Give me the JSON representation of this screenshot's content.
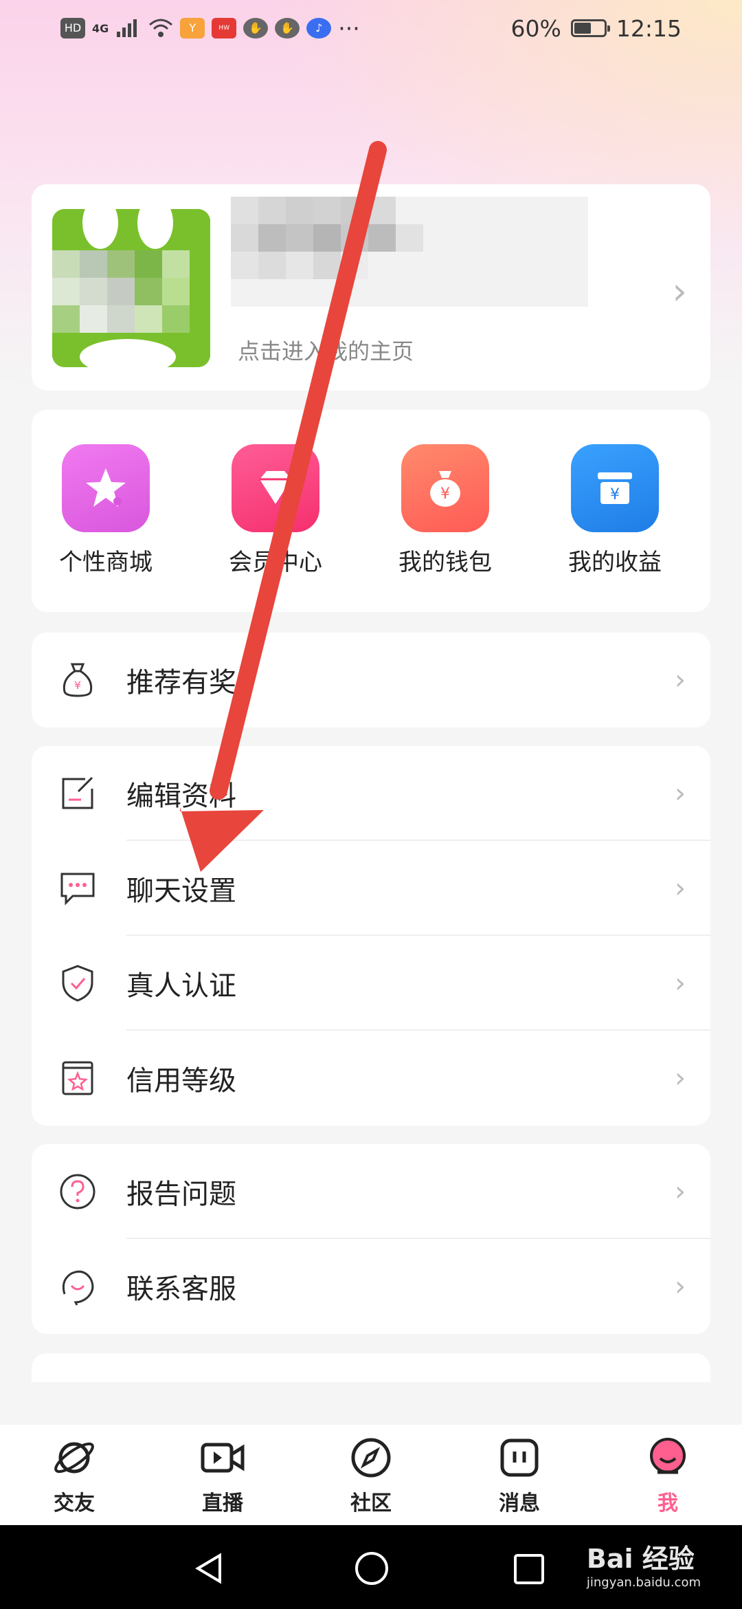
{
  "status_bar": {
    "badges": [
      "HD",
      "4G"
    ],
    "battery": "60%",
    "battery_level": 0.6,
    "time": "12:15",
    "more": "···"
  },
  "profile": {
    "subtitle": "点击进入我的主页"
  },
  "quick_actions": [
    {
      "label": "个性商城",
      "icon": "star-icon",
      "color": "#e760e6"
    },
    {
      "label": "会员中心",
      "icon": "diamond-icon",
      "color": "#ff3f86"
    },
    {
      "label": "我的钱包",
      "icon": "money-bag-icon",
      "color": "#ff6b5e"
    },
    {
      "label": "我的收益",
      "icon": "earnings-icon",
      "color": "#2f8df0"
    }
  ],
  "menu_group1": [
    {
      "label": "推荐有奖",
      "icon": "money-bag-outline-icon"
    }
  ],
  "menu_group2": [
    {
      "label": "编辑资料",
      "icon": "edit-icon"
    },
    {
      "label": "聊天设置",
      "icon": "chat-icon"
    },
    {
      "label": "真人认证",
      "icon": "shield-check-icon"
    },
    {
      "label": "信用等级",
      "icon": "credit-star-icon"
    }
  ],
  "menu_group3": [
    {
      "label": "报告问题",
      "icon": "question-icon"
    },
    {
      "label": "联系客服",
      "icon": "customer-service-icon"
    }
  ],
  "tabbar": [
    {
      "label": "交友",
      "icon": "planet-icon",
      "active": false
    },
    {
      "label": "直播",
      "icon": "video-icon",
      "active": false
    },
    {
      "label": "社区",
      "icon": "compass-icon",
      "active": false
    },
    {
      "label": "消息",
      "icon": "message-icon",
      "active": false
    },
    {
      "label": "我",
      "icon": "me-avatar-icon",
      "active": true
    }
  ],
  "watermark": {
    "text": "Bai 经验",
    "url": "jingyan.baidu.com"
  },
  "colors": {
    "accent": "#ff5f8f",
    "arrow": "#e8453c"
  }
}
